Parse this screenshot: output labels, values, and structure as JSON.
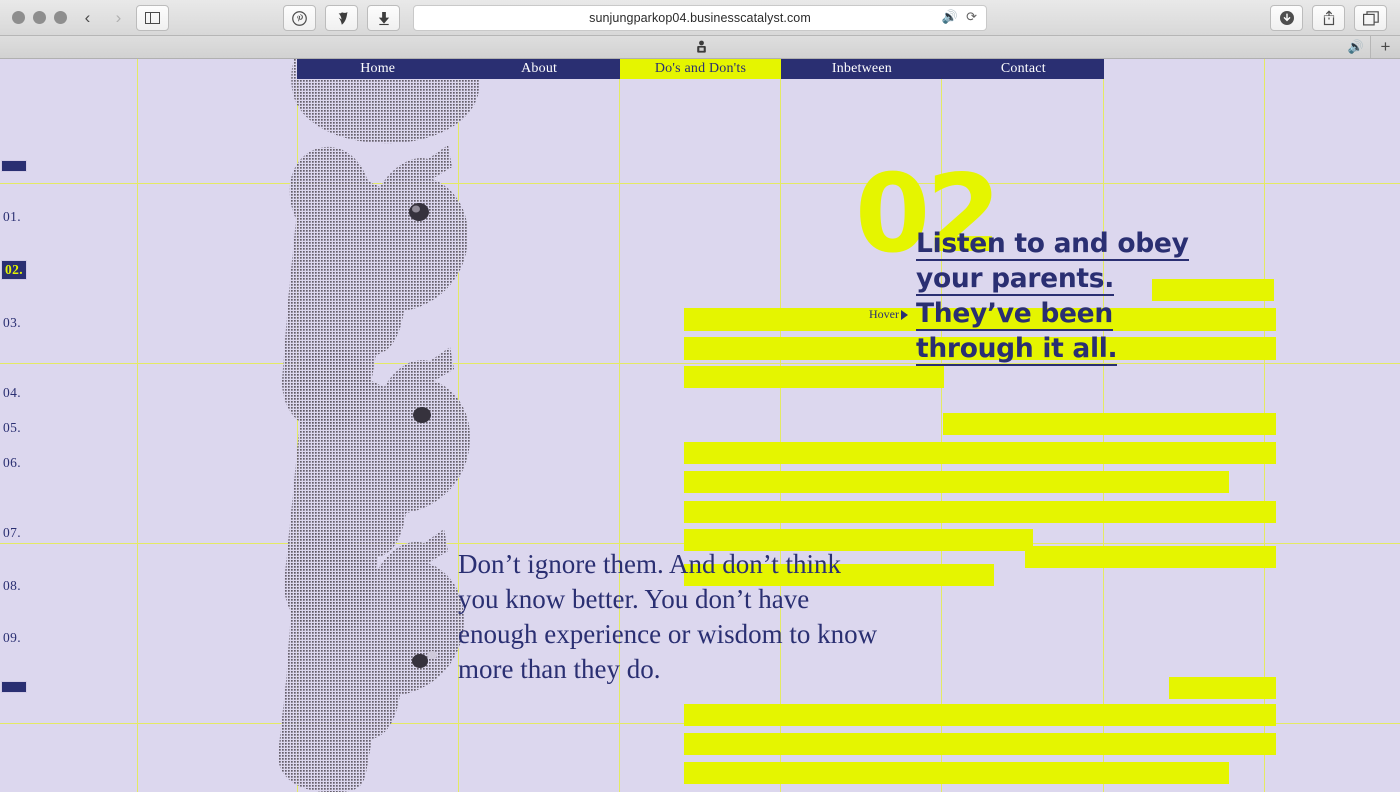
{
  "browser": {
    "url": "sunjungparkop04.businesscatalyst.com",
    "back_icon": "‹",
    "forward_icon": "›",
    "sidebar_icon": "sidebar-icon",
    "pinterest_icon": "pinterest-icon",
    "pocket_icon": "pocket-icon",
    "download_arrow_icon": "download-arrow-icon",
    "speaker_icon": "🔊",
    "reload_icon": "⟳",
    "downloads_icon": "downloads-icon",
    "share_icon": "share-icon",
    "tabs_icon": "tabs-overview-icon",
    "tab_favicon": "site-favicon",
    "tab_speaker_icon": "🔊",
    "new_tab_label": "+"
  },
  "nav": {
    "items": [
      {
        "label": "Home",
        "active": false
      },
      {
        "label": "About",
        "active": false
      },
      {
        "label": "Do's and Don'ts",
        "active": true
      },
      {
        "label": "Inbetween",
        "active": false
      },
      {
        "label": "Contact",
        "active": false
      }
    ]
  },
  "sidebar": {
    "items": [
      {
        "label": "01.",
        "active": false
      },
      {
        "label": "02.",
        "active": true
      },
      {
        "label": "03.",
        "active": false
      },
      {
        "label": "04.",
        "active": false
      },
      {
        "label": "05.",
        "active": false
      },
      {
        "label": "06.",
        "active": false
      },
      {
        "label": "07.",
        "active": false
      },
      {
        "label": "08.",
        "active": false
      },
      {
        "label": "09.",
        "active": false
      }
    ]
  },
  "main": {
    "number": "02",
    "headline": "Listen to and obey your parents. They’ve been through it all.",
    "hover_label": "Hover",
    "hover_arrow": "▶",
    "body": "Don’t ignore them. And don’t think you know better. You don’t have enough experience or wisdom to know more than they do."
  },
  "colors": {
    "background": "#dcd7ee",
    "navy": "#2a2f72",
    "yellow": "#e5f500",
    "gridline": "#e4ea63"
  }
}
